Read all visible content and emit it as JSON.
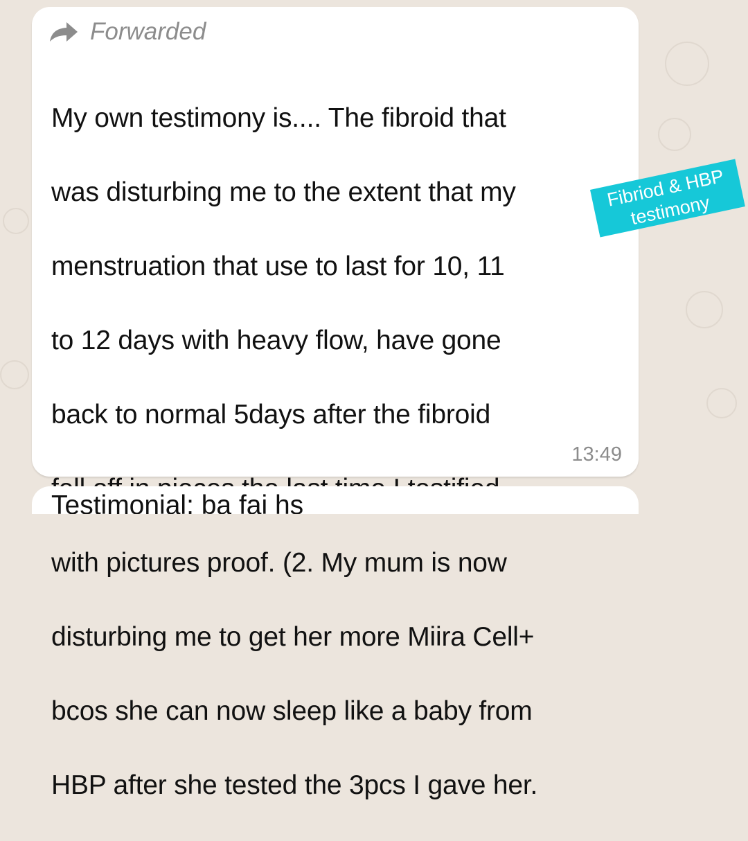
{
  "chat": {
    "forwarded_label": "Forwarded",
    "message_lines": [
      "My own testimony is.... The fibroid that",
      "was disturbing me to the extent that my",
      "menstruation that use to last for 10, 11",
      "to 12 days with heavy flow, have gone",
      "back to normal 5days after the  fibroid",
      "fell off in pieces the last time I testified",
      "with pictures proof. (2. My mum is now",
      "disturbing me to get her more Miira Cell+",
      "bcos she can now sleep like a baby from",
      "HBP after she tested the 3pcs I gave her."
    ],
    "timestamp": "13:49",
    "next_message_partial": "Testimonial: ba fai hs"
  },
  "sticker": {
    "line1": "Fibriod & HBP",
    "line2": "testimony",
    "color": "#16c8d8"
  },
  "colors": {
    "wallpaper": "#ece5dd",
    "bubble": "#ffffff",
    "meta_text": "#8c8c8c"
  },
  "icons": {
    "forward": "forward-arrow-icon"
  }
}
